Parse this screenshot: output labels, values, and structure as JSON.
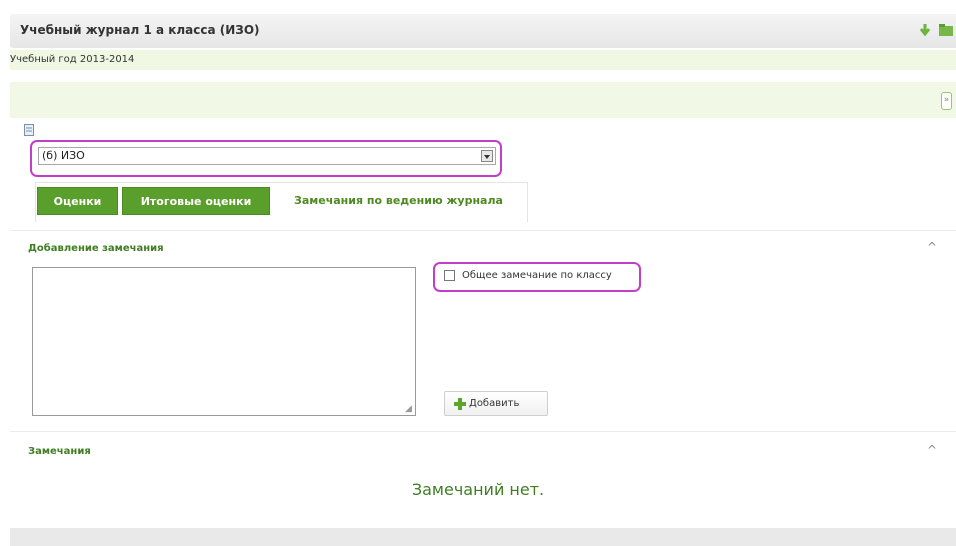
{
  "header": {
    "title": "Учебный журнал 1 а класса (ИЗО)"
  },
  "year": {
    "text": "Учебный год 2013-2014"
  },
  "subject_select": {
    "value": "(б) ИЗО"
  },
  "tabs": [
    {
      "label": "Оценки",
      "active": false
    },
    {
      "label": "Итоговые оценки",
      "active": false
    },
    {
      "label": "Замечания по ведению журнала",
      "active": true
    }
  ],
  "add_section": {
    "title": "Добавление замечания"
  },
  "comment_input": {
    "value": ""
  },
  "general_checkbox": {
    "label": "Общее замечание по классу",
    "checked": false
  },
  "add_button": {
    "label": "Добавить"
  },
  "remarks_section": {
    "title": "Замечания"
  },
  "empty_message": "Замечаний нет.",
  "colors": {
    "accent_green": "#5a9e2b",
    "highlight": "#c13ec8",
    "light_green_bg": "#f1f9e6"
  },
  "icons": [
    "arrow-down-green-icon",
    "folder-icon",
    "expand-icon",
    "document-icon",
    "dropdown-arrow-icon",
    "chevron-up-icon",
    "add-plus-icon"
  ]
}
